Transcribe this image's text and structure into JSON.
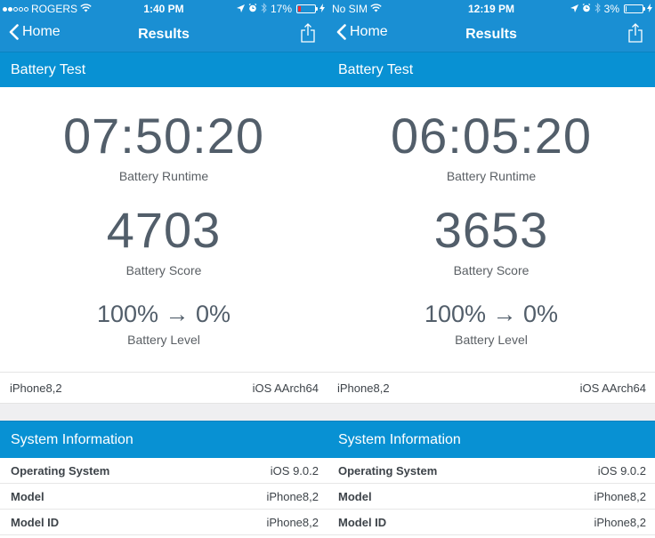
{
  "panels": [
    {
      "status_bar": {
        "signal_dots_filled": 2,
        "signal_dots_total": 5,
        "carrier": "ROGERS",
        "time": "1:40 PM",
        "battery_percent_label": "17%",
        "battery_level": 0.17,
        "battery_color": "#ff2a2a"
      },
      "nav": {
        "back_label": "Home",
        "title": "Results"
      },
      "section_battery": "Battery Test",
      "results": {
        "runtime_value": "07:50:20",
        "runtime_label": "Battery Runtime",
        "score_value": "4703",
        "score_label": "Battery Score",
        "level_value": "100% → 0%",
        "level_label": "Battery Level"
      },
      "device": {
        "model": "iPhone8,2",
        "platform": "iOS AArch64"
      },
      "section_system": "System Information",
      "system_info": [
        {
          "key": "Operating System",
          "value": "iOS 9.0.2"
        },
        {
          "key": "Model",
          "value": "iPhone8,2"
        },
        {
          "key": "Model ID",
          "value": "iPhone8,2"
        }
      ]
    },
    {
      "status_bar": {
        "carrier": "No SIM",
        "time": "12:19 PM",
        "battery_percent_label": "3%",
        "battery_level": 0.03,
        "battery_color": "#ffffff"
      },
      "nav": {
        "back_label": "Home",
        "title": "Results"
      },
      "section_battery": "Battery Test",
      "results": {
        "runtime_value": "06:05:20",
        "runtime_label": "Battery Runtime",
        "score_value": "3653",
        "score_label": "Battery Score",
        "level_value": "100% → 0%",
        "level_label": "Battery Level"
      },
      "device": {
        "model": "iPhone8,2",
        "platform": "iOS AArch64"
      },
      "section_system": "System Information",
      "system_info": [
        {
          "key": "Operating System",
          "value": "iOS 9.0.2"
        },
        {
          "key": "Model",
          "value": "iPhone8,2"
        },
        {
          "key": "Model ID",
          "value": "iPhone8,2"
        }
      ]
    }
  ],
  "colors": {
    "nav_blue": "#1a8fd3",
    "section_blue": "#0891d3",
    "metric_text": "#525e6a"
  }
}
